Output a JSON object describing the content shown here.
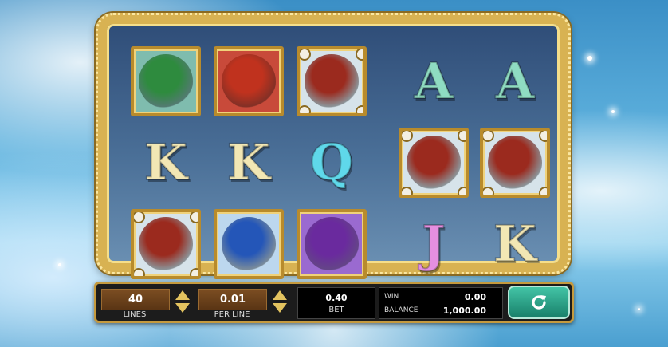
{
  "reels": {
    "row1": [
      {
        "type": "dragon",
        "name": "green-dragon",
        "color": "#2e8b3e",
        "bg": "#7fbcae"
      },
      {
        "type": "dragon",
        "name": "red-dragon",
        "color": "#c0321e",
        "bg": "#c84a3a"
      },
      {
        "type": "dragon",
        "name": "bronze-dragon",
        "color": "#9b2a1e",
        "bg": "#d6e3ea"
      },
      {
        "type": "letter",
        "letter": "A",
        "color": "#8fdcc2"
      },
      {
        "type": "letter",
        "letter": "A",
        "color": "#8fdcc2"
      }
    ],
    "row2": [
      {
        "type": "letter",
        "letter": "K",
        "color": "#f2e7b4"
      },
      {
        "type": "letter",
        "letter": "K",
        "color": "#f2e7b4"
      },
      {
        "type": "letter",
        "letter": "Q",
        "color": "#5fd8ea"
      },
      {
        "type": "dragon",
        "name": "bronze-dragon",
        "color": "#9b2a1e",
        "bg": "#d6e3ea"
      },
      {
        "type": "dragon",
        "name": "bronze-dragon",
        "color": "#9b2a1e",
        "bg": "#d6e3ea"
      }
    ],
    "row3": [
      {
        "type": "dragon",
        "name": "bronze-dragon",
        "color": "#9b2a1e",
        "bg": "#d6e3ea"
      },
      {
        "type": "dragon",
        "name": "blue-dragon",
        "color": "#2456b8",
        "bg": "#bcd7ee"
      },
      {
        "type": "dragon",
        "name": "purple-dragon",
        "color": "#6a2a9e",
        "bg": "#9a6ad0"
      },
      {
        "type": "letter",
        "letter": "J",
        "color": "#e48fe0"
      },
      {
        "type": "letter",
        "letter": "K",
        "color": "#f2e7b4"
      }
    ]
  },
  "controls": {
    "lines_value": "40",
    "lines_label": "LINES",
    "per_line_value": "0.01",
    "per_line_label": "PER LINE",
    "bet_value": "0.40",
    "bet_label": "BET",
    "win_label": "WIN",
    "win_value": "0.00",
    "balance_label": "BALANCE",
    "balance_value": "1,000.00",
    "spin_icon": "refresh-icon"
  }
}
